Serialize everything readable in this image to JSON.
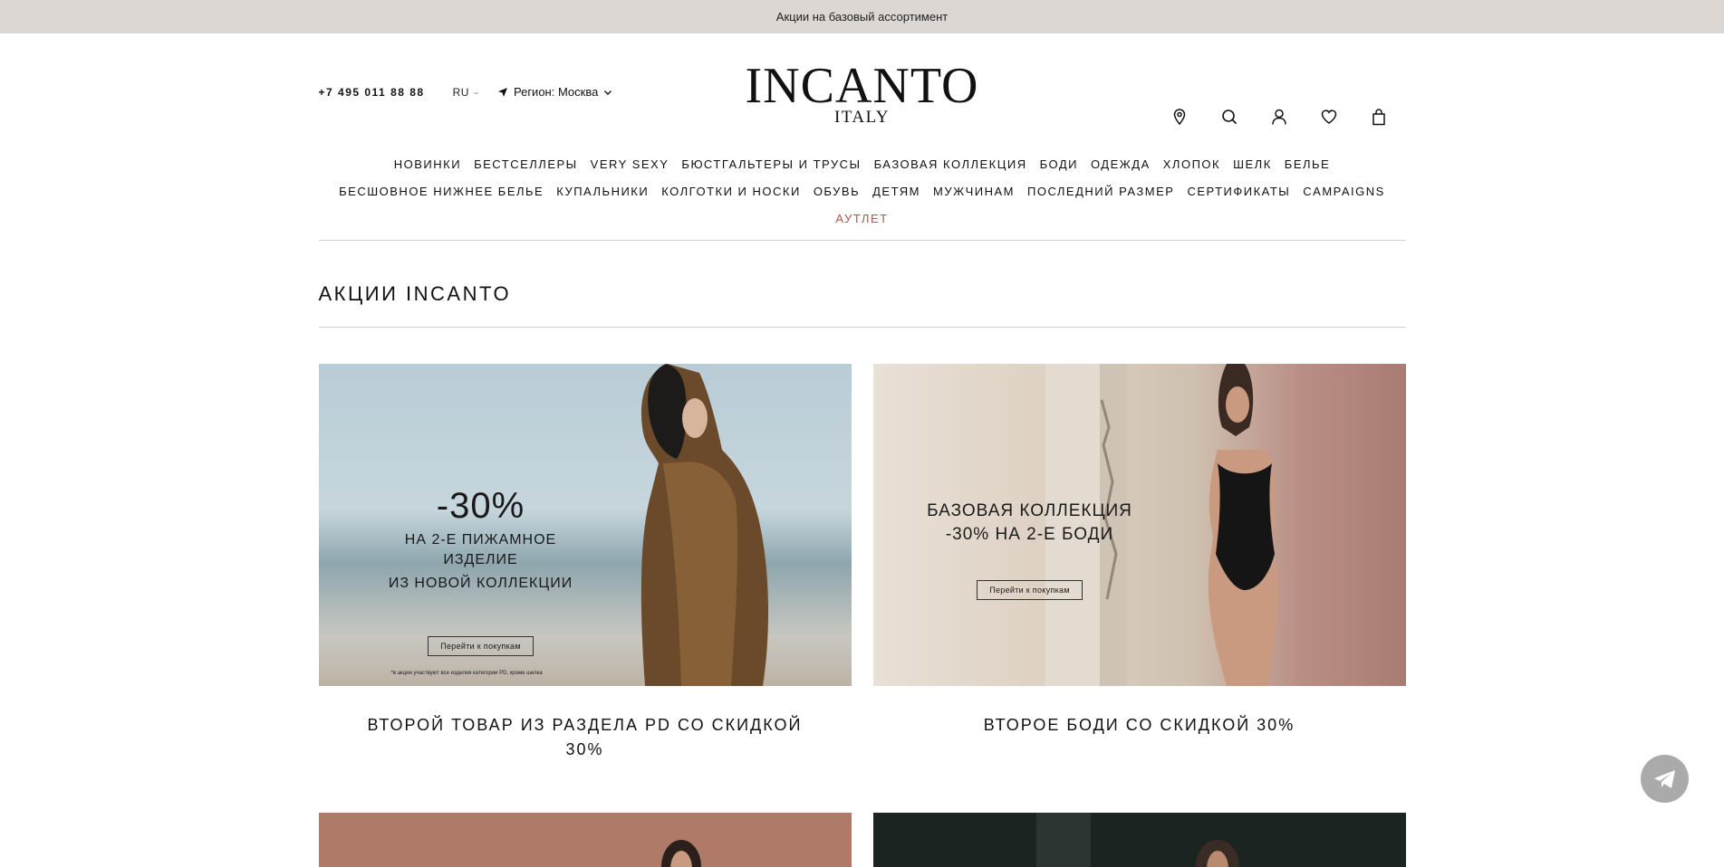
{
  "topbar": {
    "text": "Акции на базовый ассортимент"
  },
  "header": {
    "phone": "+7 495 011 88 88",
    "lang": "RU",
    "region": "Регион: Москва",
    "logo_main": "INCANTO",
    "logo_sub": "ITALY",
    "icons": [
      "map-pin-icon",
      "search-icon",
      "user-icon",
      "heart-icon",
      "bag-icon"
    ]
  },
  "nav": {
    "row1": [
      "НОВИНКИ",
      "БЕСТСЕЛЛЕРЫ",
      "VERY SEXY",
      "БЮСТГАЛЬТЕРЫ И ТРУСЫ",
      "БАЗОВАЯ КОЛЛЕКЦИЯ",
      "БОДИ",
      "ОДЕЖДА",
      "ХЛОПОК",
      "ШЕЛК",
      "БЕЛЬЕ"
    ],
    "row2": [
      "БЕСШОВНОЕ НИЖНЕЕ БЕЛЬЕ",
      "КУПАЛЬНИКИ",
      "КОЛГОТКИ И НОСКИ",
      "ОБУВЬ",
      "ДЕТЯМ",
      "МУЖЧИНАМ",
      "ПОСЛЕДНИЙ РАЗМЕР",
      "СЕРТИФИКАТЫ",
      "CAMPAIGNS"
    ],
    "outlet": "АУТЛЕТ",
    "outlet_color": "#b25545"
  },
  "page": {
    "title": "АКЦИИ INCANTO"
  },
  "promos": [
    {
      "big": "-30%",
      "line1": "НА 2-Е ПИЖАМНОЕ ИЗДЕЛИЕ",
      "line2": "ИЗ НОВОЙ КОЛЛЕКЦИИ",
      "button": "Перейти к покупкам",
      "note": "*в акции участвуют все изделия категории PD, кроме шелка",
      "caption": "ВТОРОЙ ТОВАР ИЗ РАЗДЕЛА PD СО СКИДКОЙ 30%"
    },
    {
      "line1": "БАЗОВАЯ КОЛЛЕКЦИЯ",
      "line2": "-30% НА 2-Е БОДИ",
      "button": "Перейти к покупкам",
      "caption": "ВТОРОЕ БОДИ СО СКИДКОЙ 30%"
    }
  ],
  "chat": {
    "icon": "telegram-icon"
  }
}
